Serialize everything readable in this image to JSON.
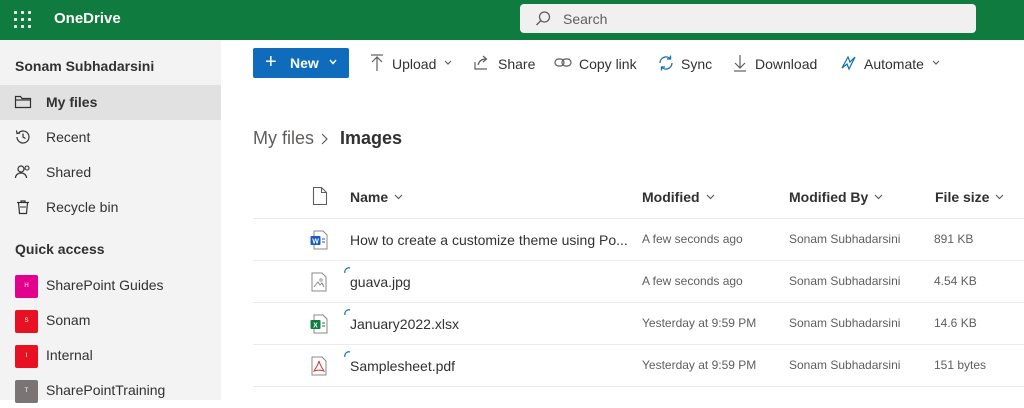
{
  "app": {
    "title": "OneDrive"
  },
  "search": {
    "placeholder": "Search"
  },
  "colors": {
    "brand": "#0f7b3f",
    "accent": "#0f6cbd",
    "sidebar": "#f3f3f3"
  },
  "sidebar": {
    "user": "Sonam Subhadarsini",
    "nav": [
      {
        "label": "My files",
        "icon": "folder-icon",
        "selected": true
      },
      {
        "label": "Recent",
        "icon": "history-icon",
        "selected": false
      },
      {
        "label": "Shared",
        "icon": "people-icon",
        "selected": false
      },
      {
        "label": "Recycle bin",
        "icon": "trash-icon",
        "selected": false
      }
    ],
    "quick_access_title": "Quick access",
    "sites": [
      {
        "label": "SharePoint Guides",
        "initial": "H",
        "color": "#e3008c"
      },
      {
        "label": "Sonam",
        "initial": "S",
        "color": "#e81123"
      },
      {
        "label": "Internal",
        "initial": "I",
        "color": "#e81123"
      },
      {
        "label": "SharePointTraining",
        "initial": "T",
        "color": "#7a7574"
      }
    ]
  },
  "commands": {
    "new_label": "New",
    "upload": "Upload",
    "share": "Share",
    "copy_link": "Copy link",
    "sync": "Sync",
    "download": "Download",
    "automate": "Automate"
  },
  "breadcrumb": {
    "parent": "My files",
    "current": "Images"
  },
  "table": {
    "columns": {
      "name": "Name",
      "modified": "Modified",
      "modified_by": "Modified By",
      "file_size": "File size"
    },
    "rows": [
      {
        "name": "How to create a customize theme using Po...",
        "modified": "A few seconds ago",
        "modified_by": "Sonam Subhadarsini",
        "size": "891 KB",
        "type": "word",
        "syncing": false
      },
      {
        "name": "guava.jpg",
        "modified": "A few seconds ago",
        "modified_by": "Sonam Subhadarsini",
        "size": "4.54 KB",
        "type": "image",
        "syncing": true
      },
      {
        "name": "January2022.xlsx",
        "modified": "Yesterday at 9:59 PM",
        "modified_by": "Sonam Subhadarsini",
        "size": "14.6 KB",
        "type": "excel",
        "syncing": true
      },
      {
        "name": "Samplesheet.pdf",
        "modified": "Yesterday at 9:59 PM",
        "modified_by": "Sonam Subhadarsini",
        "size": "151 bytes",
        "type": "pdf",
        "syncing": true
      }
    ]
  }
}
